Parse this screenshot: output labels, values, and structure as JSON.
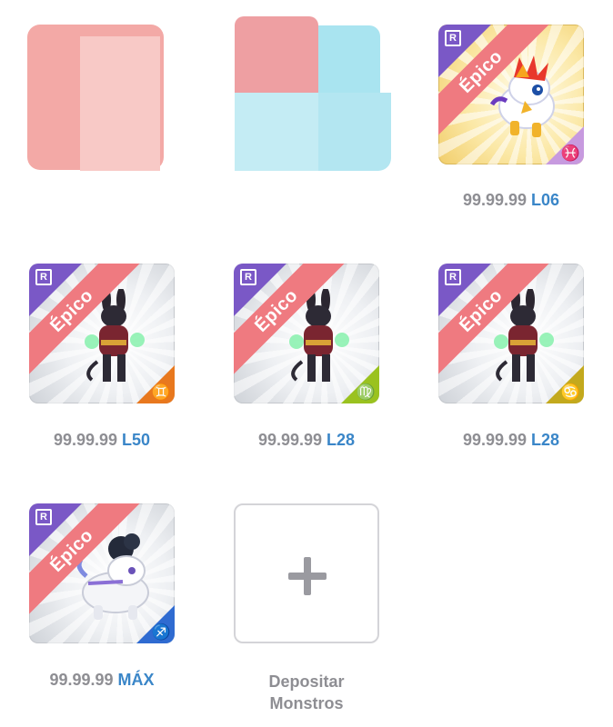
{
  "slots": [
    {
      "rarity": "Épico",
      "price": "99.99.99",
      "level": "L06",
      "sign": "♓",
      "sign_icon": "pisces-icon",
      "sign_color": "#c79adf",
      "theme": "gold"
    },
    {
      "rarity": "Épico",
      "price": "99.99.99",
      "level": "L50",
      "sign": "♊",
      "sign_icon": "gemini-icon",
      "sign_color": "#e8781e",
      "theme": "silver"
    },
    {
      "rarity": "Épico",
      "price": "99.99.99",
      "level": "L28",
      "sign": "♍",
      "sign_icon": "virgo-icon",
      "sign_color": "#9ac21f",
      "theme": "silver"
    },
    {
      "rarity": "Épico",
      "price": "99.99.99",
      "level": "L28",
      "sign": "♋",
      "sign_icon": "cancer-icon",
      "sign_color": "#c3a91d",
      "theme": "silver"
    },
    {
      "rarity": "Épico",
      "price": "99.99.99",
      "level": "MÁX",
      "sign": "♐",
      "sign_icon": "sagittarius-icon",
      "sign_color": "#2f6bd1",
      "theme": "silver"
    }
  ],
  "rarity_badge": "R",
  "deposit": {
    "line1": "Depositar",
    "line2": "Monstros"
  },
  "colors": {
    "ribbon": "#ef7a80",
    "corner": "#7a58c6",
    "price": "#8e8e93",
    "level": "#3a86c8"
  }
}
